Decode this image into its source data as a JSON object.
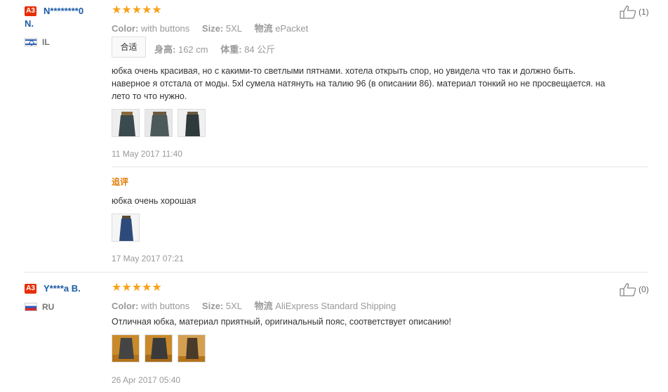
{
  "reviews": [
    {
      "badge": "A3",
      "user": "N********0",
      "user_line2": "N.",
      "country": "IL",
      "stars": "★★★★★",
      "color_label": "Color:",
      "color_value": "with buttons",
      "size_label": "Size:",
      "size_value": "5XL",
      "shipping_label": "物流",
      "shipping_value": "ePacket",
      "fit": "合适",
      "height_label": "身高:",
      "height_value": "162 cm",
      "weight_label": "体重:",
      "weight_value": "84 公斤",
      "text_lines": [
        "юбка очень красивая, но с какими-то светлыми пятнами. хотела открыть спор, но увидела что так и должно быть.",
        "наверное я отстала от моды. 5xl сумела натянуть на талию 96 (в описании 86). материал тонкий но не просвещается. на",
        "лето то что нужно."
      ],
      "date": "11 May 2017 11:40",
      "followup_title": "追评",
      "followup_text": "юбка очень хорошая",
      "followup_date": "17 May 2017 07:21",
      "helpful": "(1)"
    },
    {
      "badge": "A3",
      "user": "Y****a B.",
      "country": "RU",
      "stars": "★★★★★",
      "color_label": "Color:",
      "color_value": "with buttons",
      "size_label": "Size:",
      "size_value": "5XL",
      "shipping_label": "物流",
      "shipping_value": "AliExpress Standard Shipping",
      "text": "Отличная юбка, материал приятный, оригинальный пояс, соответствует описанию!",
      "date": "26 Apr 2017 05:40",
      "helpful": "(0)"
    }
  ]
}
